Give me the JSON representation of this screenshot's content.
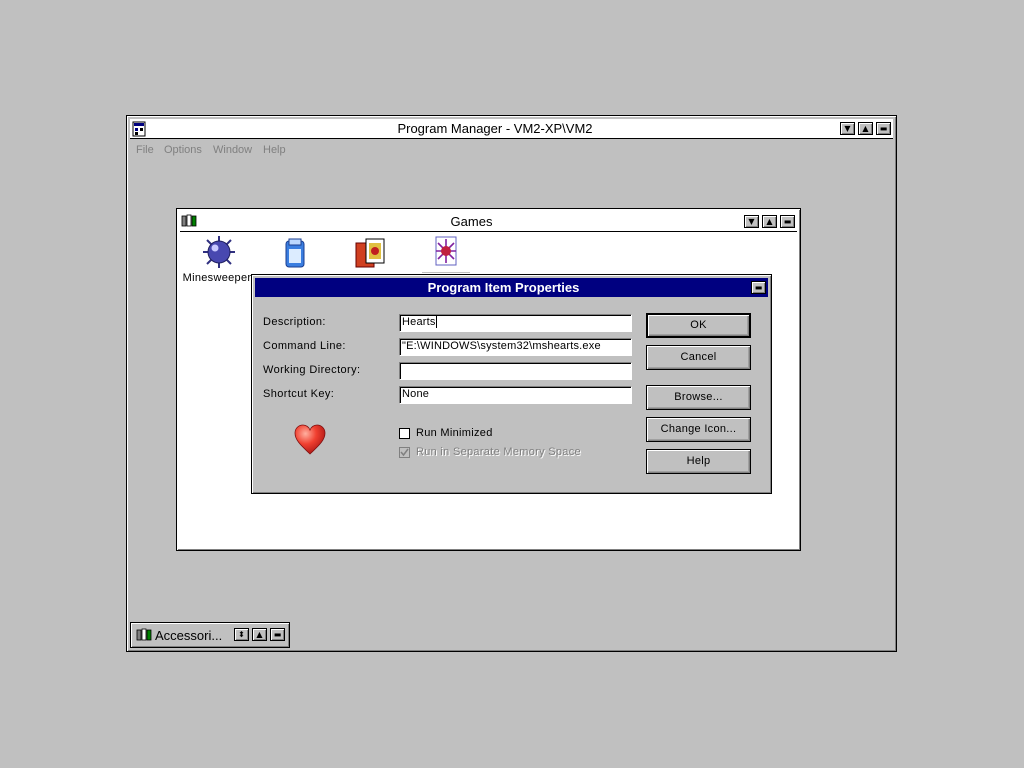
{
  "program_manager": {
    "title": "Program Manager - VM2-XP\\VM2",
    "menu": [
      "File",
      "Options",
      "Window",
      "Help"
    ]
  },
  "games_window": {
    "title": "Games",
    "icons": [
      {
        "name": "minesweeper-icon",
        "label": "Minesweeper"
      },
      {
        "name": "freecell-icon",
        "label": ""
      },
      {
        "name": "solitaire-icon",
        "label": ""
      },
      {
        "name": "spider-solitaire-icon",
        "label": ""
      }
    ]
  },
  "accessories_group": {
    "title": "Accessori..."
  },
  "dialog": {
    "title": "Program Item Properties",
    "labels": {
      "description": "Description:",
      "command_line": "Command Line:",
      "working_directory": "Working Directory:",
      "shortcut_key": "Shortcut Key:"
    },
    "values": {
      "description": "Hearts",
      "command_line": "\"E:\\WINDOWS\\system32\\mshearts.exe",
      "working_directory": "",
      "shortcut_key": "None"
    },
    "checkboxes": {
      "run_minimized": {
        "label": "Run Minimized",
        "checked": false
      },
      "separate_memory": {
        "label": "Run in Separate Memory Space",
        "checked": true,
        "disabled": true
      }
    },
    "buttons": {
      "ok": "OK",
      "cancel": "Cancel",
      "browse": "Browse...",
      "change_icon": "Change Icon...",
      "help": "Help"
    },
    "icon": "heart-icon"
  },
  "colors": {
    "desktop": "#c0c0c0",
    "active_title": "#000080",
    "inactive_title": "#ffffff",
    "disabled_text": "#808080"
  }
}
